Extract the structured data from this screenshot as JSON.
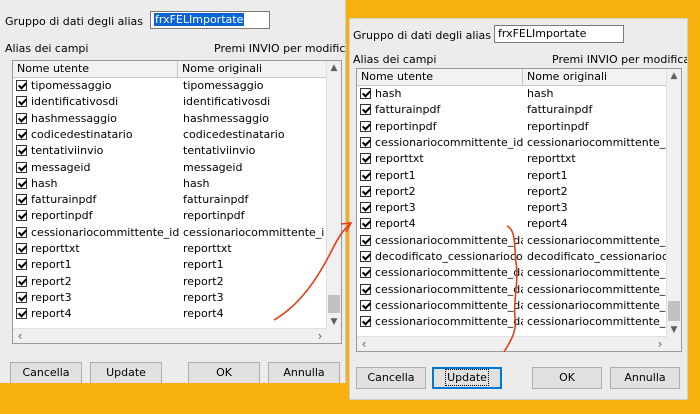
{
  "colors": {
    "background": "#f6b10f",
    "selection": "#0a64d8",
    "annotation": "#e2401a"
  },
  "left": {
    "group_label": "Gruppo di dati degli alias",
    "group_value": "frxFELImportate",
    "aliases_label": "Alias dei campi",
    "hint": "Premi INVIO per modificare",
    "col_user": "Nome utente",
    "col_orig": "Nome originali",
    "rows": [
      [
        "tipomessaggio",
        "tipomessaggio"
      ],
      [
        "identificativosdi",
        "identificativosdi"
      ],
      [
        "hashmessaggio",
        "hashmessaggio"
      ],
      [
        "codicedestinatario",
        "codicedestinatario"
      ],
      [
        "tentativiinvio",
        "tentativiinvio"
      ],
      [
        "messageid",
        "messageid"
      ],
      [
        "hash",
        "hash"
      ],
      [
        "fatturainpdf",
        "fatturainpdf"
      ],
      [
        "reportinpdf",
        "reportinpdf"
      ],
      [
        "cessionariocommittente_idfi...",
        "cessionariocommittente_id..."
      ],
      [
        "reporttxt",
        "reporttxt"
      ],
      [
        "report1",
        "report1"
      ],
      [
        "report2",
        "report2"
      ],
      [
        "report3",
        "report3"
      ],
      [
        "report4",
        "report4"
      ]
    ],
    "buttons": {
      "cancel": "Cancella",
      "update": "Update",
      "ok": "OK",
      "annulla": "Annulla"
    }
  },
  "right": {
    "group_label": "Gruppo di dati degli alias",
    "group_value": "frxFELImportate",
    "aliases_label": "Alias dei campi",
    "hint": "Premi INVIO per modificare",
    "col_user": "Nome utente",
    "col_orig": "Nome originali",
    "rows": [
      [
        "hash",
        "hash"
      ],
      [
        "fatturainpdf",
        "fatturainpdf"
      ],
      [
        "reportinpdf",
        "reportinpdf"
      ],
      [
        "cessionariocommittente_idfi...",
        "cessionariocommittente_id..."
      ],
      [
        "reporttxt",
        "reporttxt"
      ],
      [
        "report1",
        "report1"
      ],
      [
        "report2",
        "report2"
      ],
      [
        "report3",
        "report3"
      ],
      [
        "report4",
        "report4"
      ],
      [
        "cessionariocommittente_dati...",
        "cessionariocommittente_d..."
      ],
      [
        "decodificato_cessionariocom...",
        "decodificato_cessionarioc..."
      ],
      [
        "cessionariocommittente_dati...",
        "cessionariocommittente_d..."
      ],
      [
        "cessionariocommittente_dati...",
        "cessionariocommittente_d..."
      ],
      [
        "cessionariocommittente_dati...",
        "cessionariocommittente_d..."
      ],
      [
        "cessionariocommittente_dati...",
        "cessionariocommittente_d..."
      ]
    ],
    "buttons": {
      "cancel": "Cancella",
      "update": "Update",
      "ok": "OK",
      "annulla": "Annulla"
    }
  }
}
